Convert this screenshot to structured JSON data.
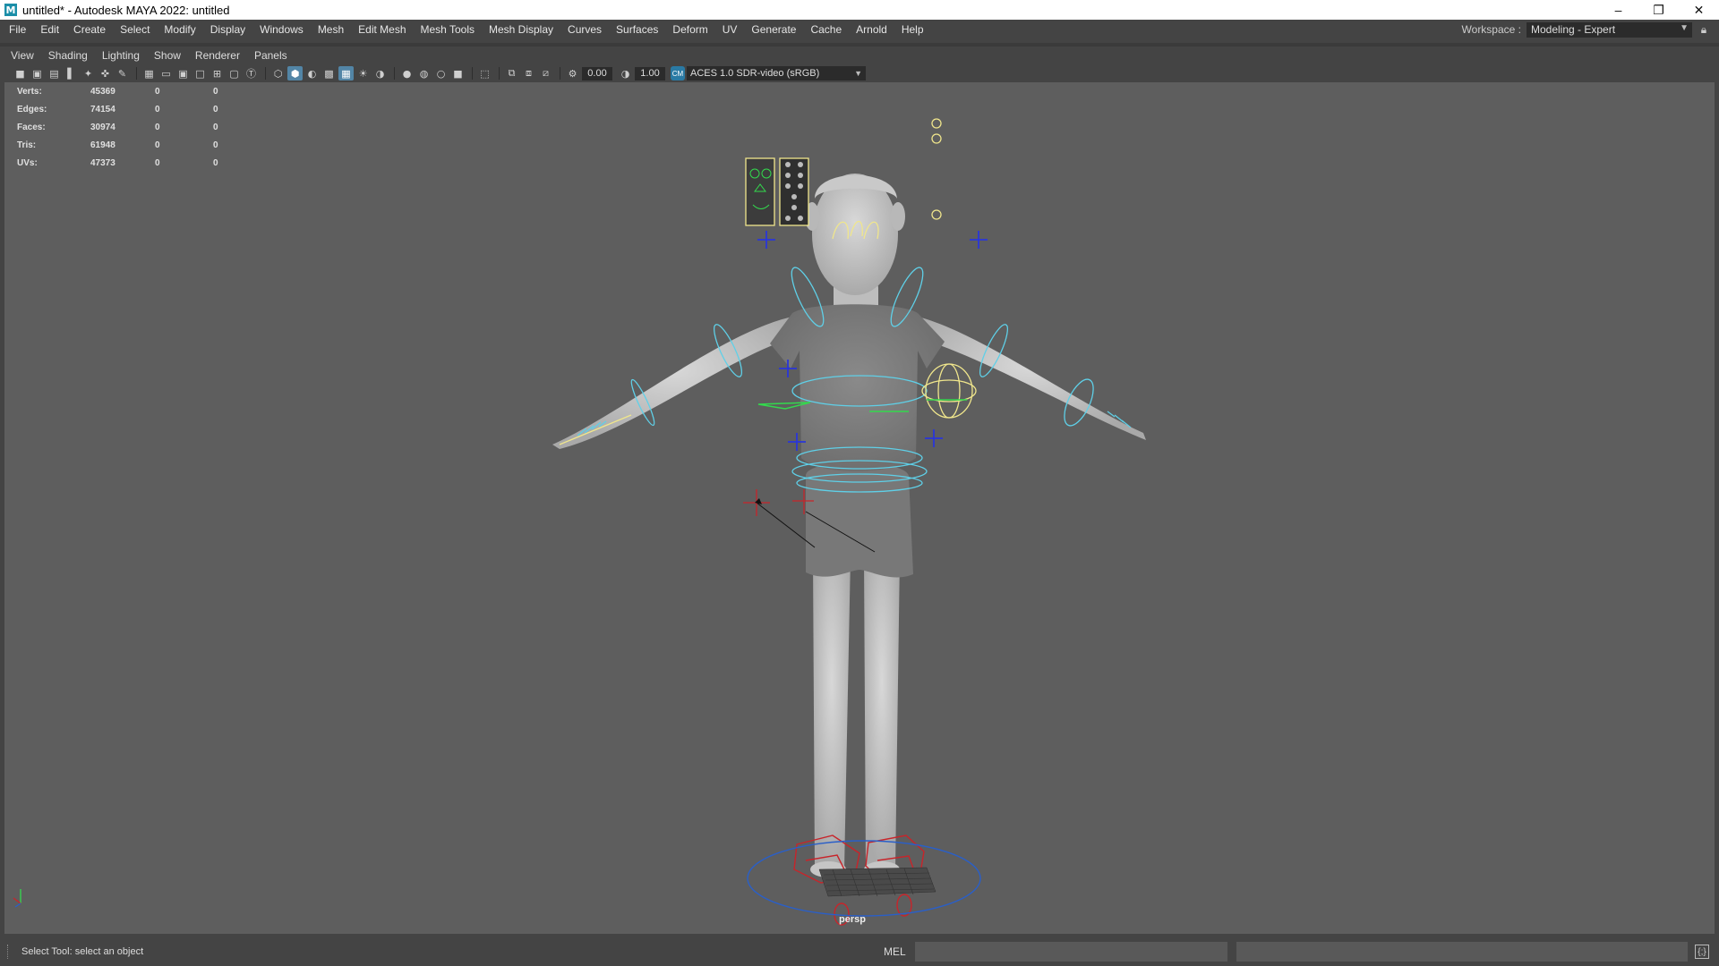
{
  "window": {
    "title": "untitled* - Autodesk MAYA 2022: untitled",
    "app_icon": "M",
    "controls": [
      "minimize-icon",
      "restore-icon",
      "close-icon"
    ]
  },
  "menubar": {
    "items": [
      "File",
      "Edit",
      "Create",
      "Select",
      "Modify",
      "Display",
      "Windows",
      "Mesh",
      "Edit Mesh",
      "Mesh Tools",
      "Mesh Display",
      "Curves",
      "Surfaces",
      "Deform",
      "UV",
      "Generate",
      "Cache",
      "Arnold",
      "Help"
    ]
  },
  "workspace": {
    "label": "Workspace :",
    "value": "Modeling - Expert"
  },
  "panel_menu": {
    "items": [
      "View",
      "Shading",
      "Lighting",
      "Show",
      "Renderer",
      "Panels"
    ]
  },
  "viewport_toolbar": {
    "gate_value": "0.00",
    "gamma_value": "1.00",
    "color_space": "ACES 1.0 SDR-video (sRGB)"
  },
  "hud": {
    "rows": [
      {
        "label": "Verts:",
        "v1": "45369",
        "v2": "0",
        "v3": "0"
      },
      {
        "label": "Edges:",
        "v1": "74154",
        "v2": "0",
        "v3": "0"
      },
      {
        "label": "Faces:",
        "v1": "30974",
        "v2": "0",
        "v3": "0"
      },
      {
        "label": "Tris:",
        "v1": "61948",
        "v2": "0",
        "v3": "0"
      },
      {
        "label": "UVs:",
        "v1": "47373",
        "v2": "0",
        "v3": "0"
      }
    ]
  },
  "viewport": {
    "camera_label": "persp",
    "background_color": "#5e5e5e"
  },
  "statusbar": {
    "help_text": "Select Tool: select an object",
    "command_language": "MEL"
  }
}
